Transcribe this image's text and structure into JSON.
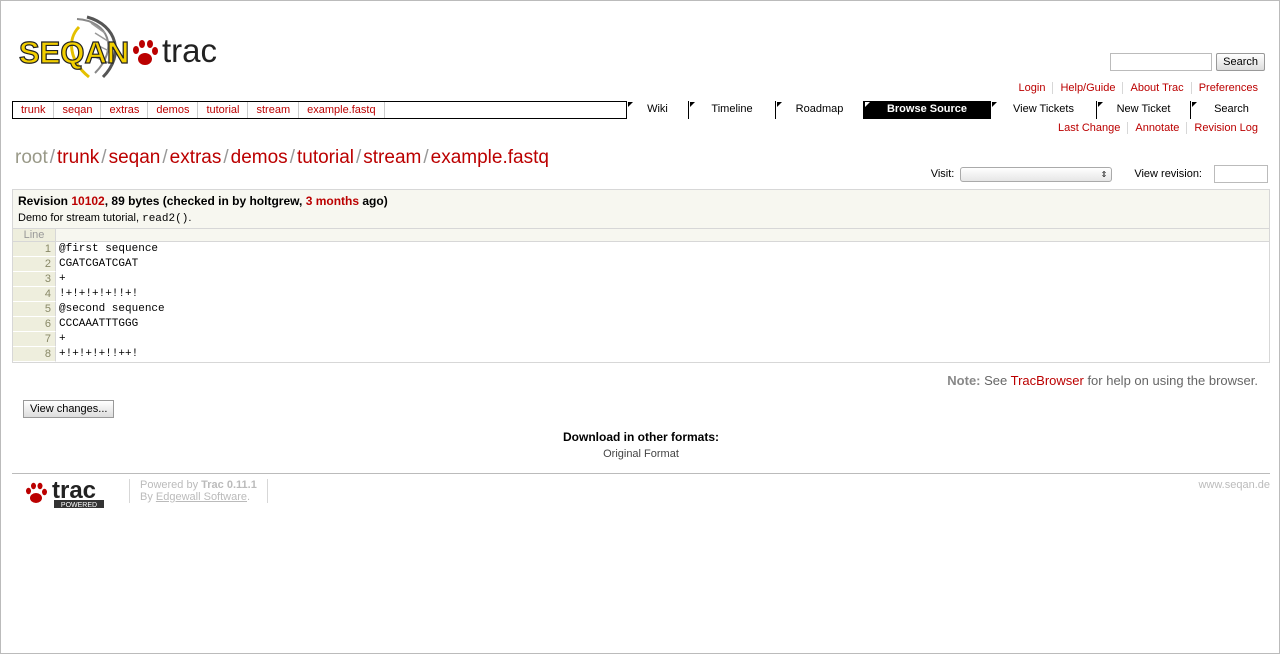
{
  "logo": {
    "text_left": "SEQAN",
    "text_right": "trac"
  },
  "search": {
    "placeholder": "",
    "button": "Search"
  },
  "metanav": [
    "Login",
    "Help/Guide",
    "About Trac",
    "Preferences"
  ],
  "path_links": [
    "trunk",
    "seqan",
    "extras",
    "demos",
    "tutorial",
    "stream",
    "example.fastq"
  ],
  "mainnav": [
    {
      "label": "Wiki",
      "active": false
    },
    {
      "label": "Timeline",
      "active": false
    },
    {
      "label": "Roadmap",
      "active": false
    },
    {
      "label": "Browse Source",
      "active": true
    },
    {
      "label": "View Tickets",
      "active": false
    },
    {
      "label": "New Ticket",
      "active": false
    },
    {
      "label": "Search",
      "active": false
    }
  ],
  "ctxtnav": [
    "Last Change",
    "Annotate",
    "Revision Log"
  ],
  "title_path": {
    "root": "root",
    "parts": [
      "trunk",
      "seqan",
      "extras",
      "demos",
      "tutorial",
      "stream",
      "example.fastq"
    ]
  },
  "visit": {
    "label": "Visit:",
    "value": ""
  },
  "view_revision": {
    "label": "View revision:",
    "value": ""
  },
  "info": {
    "prefix": "Revision ",
    "revision": "10102",
    "middle": ", 89 bytes (checked in by holtgrew, ",
    "age": "3 months",
    "suffix": " ago)",
    "message_text": "Demo for stream tutorial, ",
    "message_code": "read2()",
    "message_end": "."
  },
  "code": {
    "header": "Line",
    "lines": [
      "@first sequence",
      "CGATCGATCGAT",
      "+",
      "!+!+!+!+!!+!",
      "@second sequence",
      "CCCAAATTTGGG",
      "+",
      "+!+!+!+!!++!"
    ]
  },
  "note": {
    "label": "Note:",
    "pre": " See ",
    "link": "TracBrowser",
    "post": " for help on using the browser."
  },
  "view_changes": "View changes...",
  "download": {
    "title": "Download in other formats:",
    "link": "Original Format"
  },
  "footer": {
    "powered_by": "Powered by ",
    "trac_version": "Trac 0.11.1",
    "by": "By ",
    "company": "Edgewall Software",
    "company_end": ".",
    "site": "www.seqan.de",
    "trac_logo_text": "trac",
    "trac_logo_sub": "POWERED"
  },
  "colors": {
    "link": "#bb0000",
    "nav_active_bg": "#000000",
    "line_bg": "#eeeedd",
    "info_bg": "#f7f7f0"
  }
}
